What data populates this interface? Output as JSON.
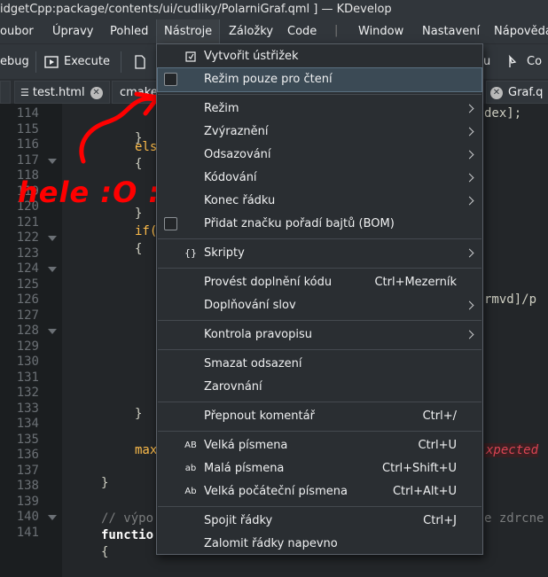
{
  "window": {
    "title": "idgetCpp:package/contents/ui/cudliky/PolarniGraf.qml ] — KDevelop"
  },
  "menubar": {
    "items": [
      "oubor",
      "Úpravy",
      "Pohled",
      "Nástroje",
      "Záložky",
      "Code",
      "Window",
      "Nastavení",
      "Nápověda"
    ],
    "active": "Nástroje"
  },
  "toolbar": {
    "debug_label": "ebug",
    "execute_label": "Execute",
    "partial_right": "Co",
    "partial_mid": "u"
  },
  "tabs": [
    {
      "label": "test.html"
    },
    {
      "label": "cmake"
    },
    {
      "label": "Graf.q"
    }
  ],
  "annotation": {
    "text": "hele :O :O"
  },
  "editor": {
    "line_numbers": [
      "114",
      "115",
      "116",
      "117",
      "118",
      "119",
      "120",
      "121",
      "122",
      "123",
      "124",
      "125",
      "126",
      "127",
      "128",
      "129",
      "130",
      "131",
      "132",
      "133",
      "134",
      "135",
      "136",
      "137",
      "138",
      "139",
      "140",
      "141"
    ],
    "snippets": {
      "l114_right": "dex];",
      "l115": "}",
      "l116": "els",
      "l117": "{",
      "l120": "}",
      "l121": "if(",
      "l122": "{",
      "l125_right": "rmvd]/p",
      "l132": "}",
      "l134_left": "max",
      "l134_right": "xpected",
      "l136": "}",
      "l138_left": "// výpo",
      "l138_right": "e zdrcne",
      "l139": "functio",
      "l140": "{"
    }
  },
  "dropdown": {
    "items": [
      {
        "id": "screenshot",
        "label": "Vytvořit ústřižek",
        "icon": "screenshot-icon",
        "shortcut": ""
      },
      {
        "id": "readonly",
        "label": "Režim pouze pro čtení",
        "checkbox": true,
        "checked": false,
        "shortcut": ""
      },
      {
        "id": "mode",
        "label": "Režim",
        "submenu": true
      },
      {
        "id": "highlight",
        "label": "Zvýraznění",
        "submenu": true
      },
      {
        "id": "indent",
        "label": "Odsazování",
        "submenu": true
      },
      {
        "id": "encoding",
        "label": "Kódování",
        "submenu": true
      },
      {
        "id": "eol",
        "label": "Konec řádku",
        "submenu": true
      },
      {
        "id": "bom",
        "label": "Přidat značku pořadí bajtů (BOM)",
        "checkbox": true,
        "checked": false
      },
      {
        "id": "scripts",
        "label": "Skripty",
        "icon": "scripts-icon",
        "submenu": true
      },
      {
        "id": "complete",
        "label": "Provést doplnění kódu",
        "shortcut": "Ctrl+Mezerník"
      },
      {
        "id": "wordcomplete",
        "label": "Doplňování slov",
        "submenu": true
      },
      {
        "id": "spell",
        "label": "Kontrola pravopisu",
        "submenu": true
      },
      {
        "id": "cleanindent",
        "label": "Smazat odsazení"
      },
      {
        "id": "align",
        "label": "Zarovnání"
      },
      {
        "id": "togglecomment",
        "label": "Přepnout komentář",
        "shortcut": "Ctrl+/"
      },
      {
        "id": "upper",
        "label": "Velká písmena",
        "icon": "uppercase-icon",
        "shortcut": "Ctrl+U"
      },
      {
        "id": "lower",
        "label": "Malá písmena",
        "icon": "lowercase-icon",
        "shortcut": "Ctrl+Shift+U"
      },
      {
        "id": "capitalize",
        "label": "Velká počáteční písmena",
        "icon": "capitalize-icon",
        "shortcut": "Ctrl+Alt+U"
      },
      {
        "id": "join",
        "label": "Spojit řádky",
        "shortcut": "Ctrl+J"
      },
      {
        "id": "wrap",
        "label": "Zalomit řádky napevno"
      }
    ],
    "icon_glyphs": {
      "uppercase": "AB",
      "lowercase": "ab",
      "capitalize": "Ab",
      "scripts": "{}"
    }
  },
  "colors": {
    "annotation": "#ff0000",
    "menu_bg": "#2a2e32",
    "highlight": "#3b4a55",
    "editor_bg": "#232629"
  }
}
